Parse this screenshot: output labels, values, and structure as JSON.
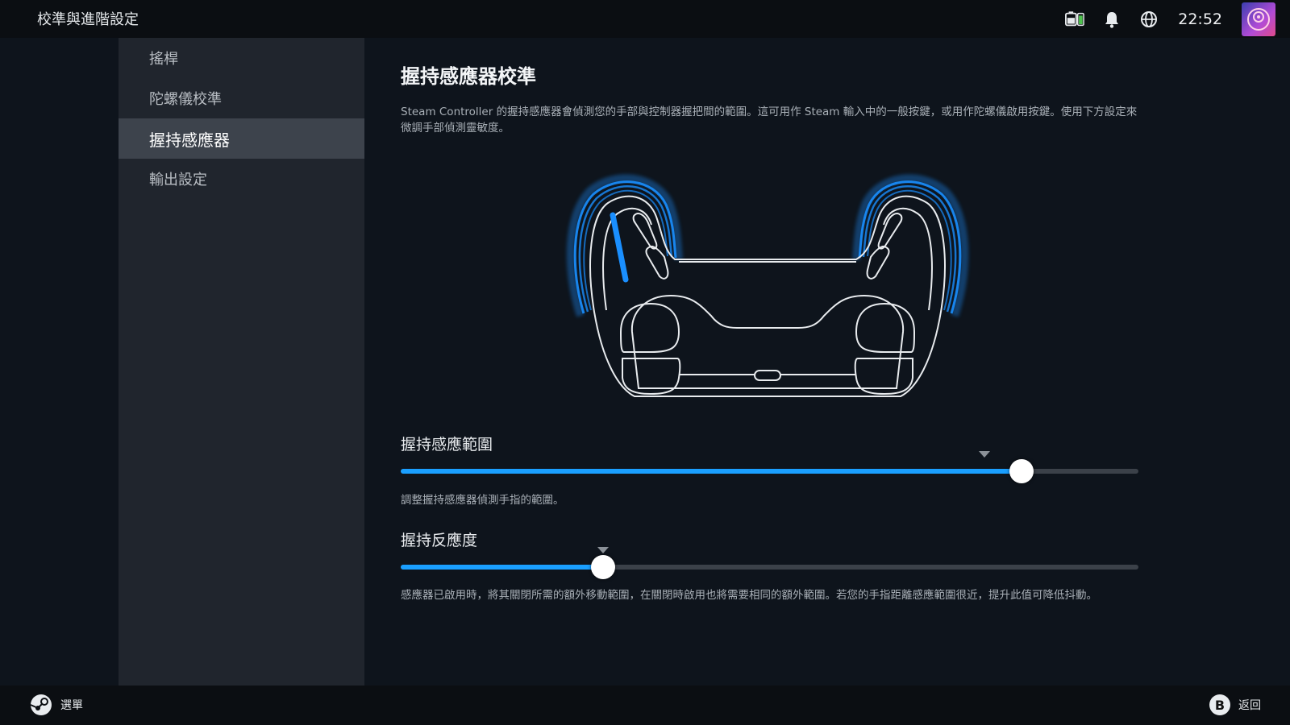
{
  "header": {
    "title": "校準與進階設定",
    "clock": "22:52",
    "icons": [
      "battery-icon",
      "bell-icon",
      "globe-icon",
      "avatar"
    ]
  },
  "sidebar": {
    "items": [
      {
        "label": "搖桿"
      },
      {
        "label": "陀螺儀校準"
      },
      {
        "label": "握持感應器",
        "active": true
      },
      {
        "label": "輸出設定"
      }
    ]
  },
  "main": {
    "title": "握持感應器校準",
    "description": "Steam Controller 的握持感應器會偵測您的手部與控制器握把間的範圍。這可用作 Steam 輸入中的一般按鍵，或用作陀螺儀啟用按鍵。使用下方設定來微調手部偵測靈敏度。",
    "sliders": [
      {
        "label": "握持感應範圍",
        "value_fraction": 0.842,
        "notch_fraction": 0.791,
        "help": "調整握持感應器偵測手指的範圍。"
      },
      {
        "label": "握持反應度",
        "value_fraction": 0.274,
        "notch_fraction": 0.274,
        "help": "感應器已啟用時，將其關閉所需的額外移動範圍，在關閉時啟用也將需要相同的額外範圍。若您的手指距離感應範圍很近，提升此值可降低抖動。"
      }
    ]
  },
  "footer": {
    "menu_label": "選單",
    "back_button": "B",
    "back_label": "返回"
  },
  "colors": {
    "accent": "#1a9fff",
    "sidebar_bg": "#20252d",
    "active_bg": "#3d434c"
  }
}
